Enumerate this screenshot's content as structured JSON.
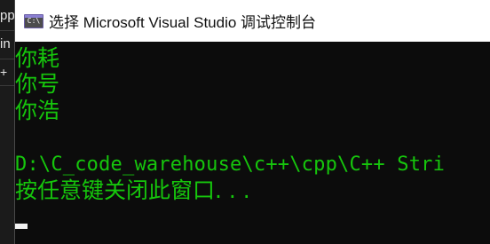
{
  "background_window": {
    "fragments": [
      "pp",
      "in",
      "+ "
    ]
  },
  "console_window": {
    "title": "选择 Microsoft Visual Studio 调试控制台",
    "icon": {
      "name": "console-app-icon",
      "glyph": "C:\\"
    },
    "lines": [
      "你耗",
      "你号",
      "你浩",
      "",
      "D:\\C_code_warehouse\\c++\\cpp\\C++ Stri",
      "按任意键关闭此窗口. . ."
    ],
    "text_color": "#16c60c",
    "background_color": "#0c0c0c"
  }
}
